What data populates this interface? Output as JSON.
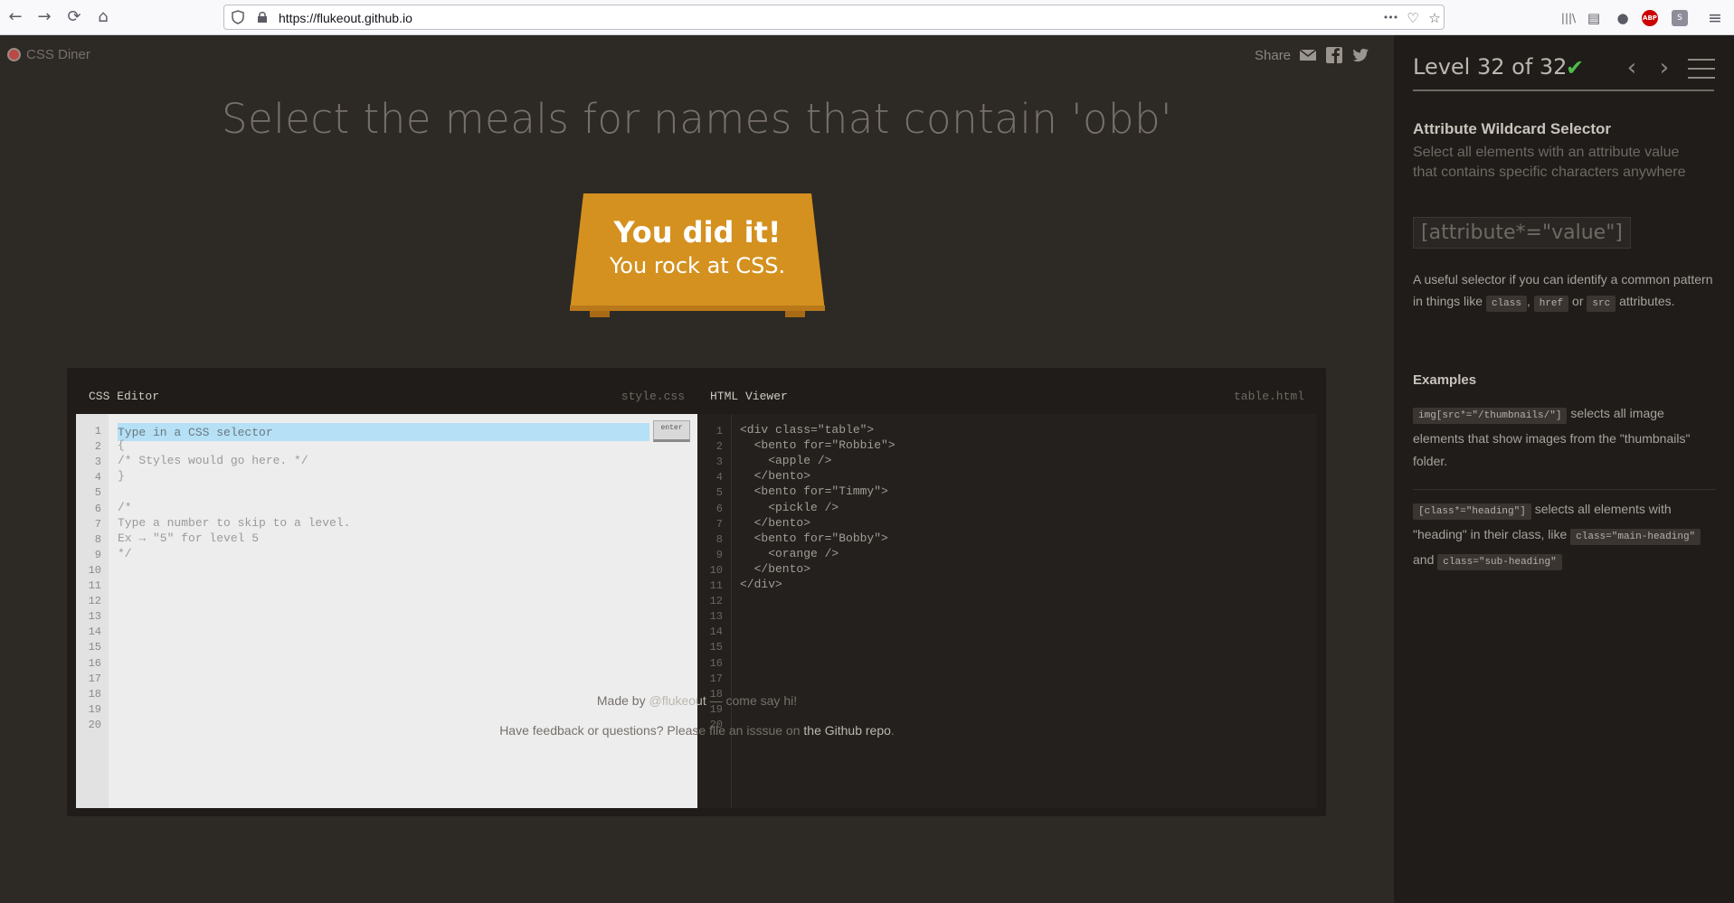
{
  "browser": {
    "url": "https://flukeout.github.io",
    "back_icon": "←",
    "forward_icon": "→",
    "reload_icon": "⟳",
    "home_icon": "⌂",
    "more_icon": "•••",
    "pocket_icon": "♡",
    "star_icon": "☆",
    "library_icon": "|||\\",
    "reader_icon": "▤",
    "account_icon": "●",
    "abp_label": "ABP",
    "ext_label": "S",
    "menu_icon": "≡"
  },
  "game": {
    "logo_text": "CSS Diner",
    "share_label": "Share",
    "order_text": "Select the meals for names that contain 'obb'",
    "table_line1": "You did it!",
    "table_line2": "You rock at CSS."
  },
  "editor": {
    "css_title": "CSS Editor",
    "css_file": "style.css",
    "html_title": "HTML Viewer",
    "html_file": "table.html",
    "input_placeholder": "Type in a CSS selector",
    "enter_label": "enter",
    "line_numbers": [
      "1",
      "2",
      "3",
      "4",
      "5",
      "6",
      "7",
      "8",
      "9",
      "10",
      "11",
      "12",
      "13",
      "14",
      "15",
      "16",
      "17",
      "18",
      "19",
      "20"
    ],
    "css_lines": [
      "",
      "{",
      "/* Styles would go here. */",
      "}",
      "",
      "/*",
      "Type a number to skip to a level.",
      "Ex → \"5\" for level 5",
      "*/"
    ],
    "html_lines": [
      "<div class=\"table\">",
      "  <bento for=\"Robbie\">",
      "    <apple />",
      "  </bento>",
      "  <bento for=\"Timmy\">",
      "    <pickle />",
      "  </bento>",
      "  <bento for=\"Bobby\">",
      "    <orange />",
      "  </bento>",
      "</div>"
    ]
  },
  "footer": {
    "made_by_prefix": "Made by ",
    "made_by_link": "@flukeout",
    "made_by_suffix": " — come say hi!",
    "feedback_prefix": "Have feedback or questions? Please file an isssue on ",
    "feedback_link": "the Github repo",
    "feedback_suffix": "."
  },
  "sidebar": {
    "level_title": "Level 32 of 32",
    "check_icon": "✔",
    "prev_icon": "‹",
    "next_icon": "›",
    "progress": 1.0,
    "selector_name": "Attribute Wildcard Selector",
    "selector_title": "Select all elements with an attribute value that contains specific characters anywhere",
    "syntax": "[attribute*=\"value\"]",
    "hint_pre": "A useful selector if you can identify a common pattern in things like ",
    "hint_code1": "class",
    "hint_sep1": ", ",
    "hint_code2": "href",
    "hint_sep2": " or ",
    "hint_code3": "src",
    "hint_post": " attributes.",
    "examples_title": "Examples",
    "ex1_code": "img[src*=\"/thumbnails/\"]",
    "ex1_text": " selects all image elements that show images from the \"thumbnails\" folder.",
    "ex2_code": "[class*=\"heading\"]",
    "ex2_text1": " selects all elements with \"heading\" in their class, like ",
    "ex2_code2": "class=\"main-heading\"",
    "ex2_and": " and ",
    "ex2_code3": "class=\"sub-heading\""
  }
}
